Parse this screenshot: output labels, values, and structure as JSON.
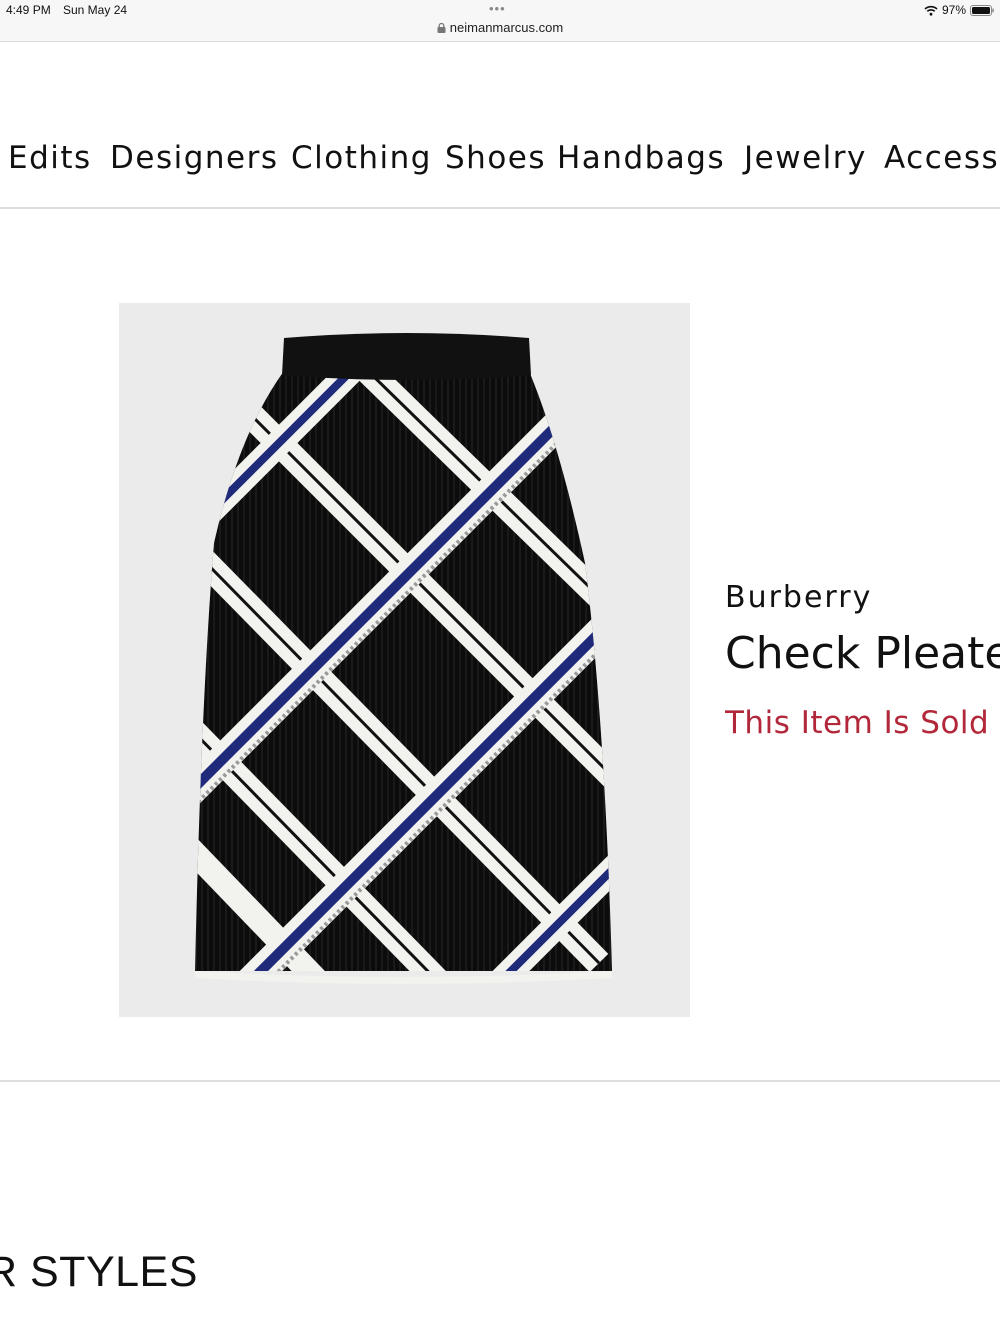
{
  "status_bar": {
    "time": "4:49 PM",
    "date": "Sun May 24",
    "dots": "•••",
    "url": "neimanmarcus.com",
    "battery": "97%"
  },
  "nav": {
    "items": [
      "Edits",
      "Designers",
      "Clothing",
      "Shoes",
      "Handbags",
      "Jewelry",
      "Accesso"
    ]
  },
  "product": {
    "brand": "Burberry",
    "name": "Check Pleate",
    "availability": "This Item Is Sold Ou",
    "image_icon": "plaid-pleated-skirt-image"
  },
  "section": {
    "heading": "R STYLES"
  },
  "colors": {
    "sold_out_red": "#b2283a",
    "image_bg": "#ebebeb",
    "skirt_navy": "#1f2a7a"
  }
}
